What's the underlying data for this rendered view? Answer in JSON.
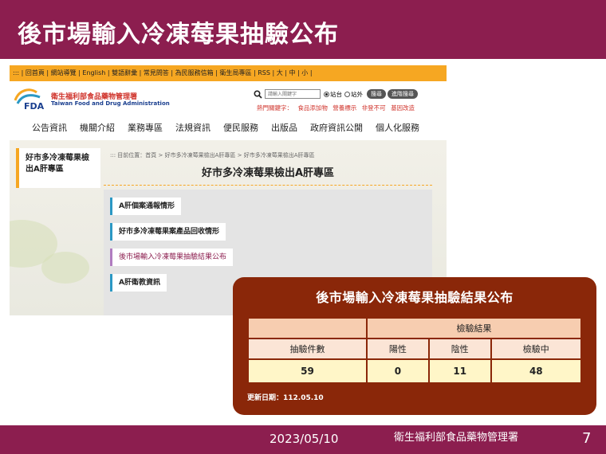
{
  "slide": {
    "title": "後市場輸入冷凍莓果抽驗公布",
    "footer_date": "2023/05/10",
    "footer_org": "衛生福利部食品藥物管理署",
    "page_number": "7"
  },
  "site": {
    "topbar": ":::  | 回首頁 | 網站導覽 | English | 雙語辭彙 | 常見問答 | 為民服務信箱 | 衛生局專區 | RSS | 大 | 中 | 小 |",
    "logo_cn": "衛生福利部食品藥物管理署",
    "logo_en": "Taiwan Food and Drug Administration",
    "logo_mark": "FDA",
    "search_placeholder": "請輸入關鍵字",
    "radio_site": "站台",
    "radio_out": "站外",
    "search_btn": "搜尋",
    "advanced_btn": "進階搜尋",
    "hot_label": "熱門關鍵字：",
    "hot_keywords": [
      "食品添加物",
      "營養標示",
      "非登不可",
      "基因改造"
    ],
    "nav": [
      "公告資訊",
      "機關介紹",
      "業務專區",
      "法規資訊",
      "便民服務",
      "出版品",
      "政府資訊公開",
      "個人化服務"
    ],
    "side_title": "好市多冷凍莓果檢出A肝專區",
    "breadcrumb": ":::  目前位置：首頁 > 好市多冷凍莓果檢出A肝專區 > 好市多冷凍莓果檢出A肝專區",
    "content_title": "好市多冷凍莓果檢出A肝專區",
    "list": [
      "A肝個案通報情形",
      "好市多冷凍莓果案產品回收情形",
      "後市場輸入冷凍莓果抽驗結果公布",
      "A肝衛教資訊"
    ]
  },
  "result": {
    "title": "後市場輸入冷凍莓果抽驗結果公布",
    "group_header": "檢驗結果",
    "headers": [
      "抽驗件數",
      "陽性",
      "陰性",
      "檢驗中"
    ],
    "values": [
      "59",
      "0",
      "11",
      "48"
    ],
    "updated": "更新日期：112.05.10"
  },
  "colors": {
    "brand": "#8c1e4f",
    "accent": "#f6a722",
    "card": "#8a2709"
  }
}
